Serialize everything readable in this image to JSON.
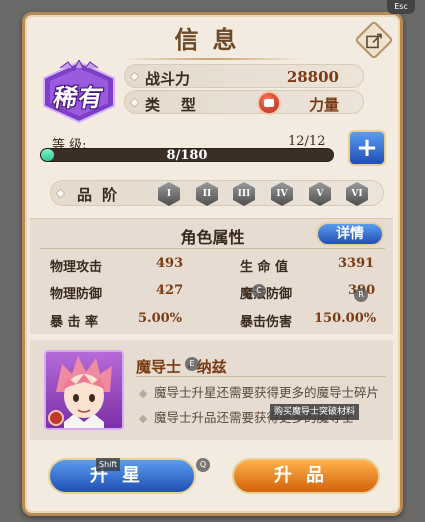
{
  "window": {
    "esc_label": "Esc"
  },
  "header": {
    "title": "信息"
  },
  "rarity": {
    "label": "稀有"
  },
  "stats": {
    "power_label": "战斗力",
    "power_value": "28800",
    "type_label": "类    型",
    "type_value": "力量"
  },
  "level": {
    "label": "等 级:",
    "count": "12/12",
    "xp_text": "8/180",
    "xp_fraction": 0.044
  },
  "grade": {
    "label": "品阶",
    "tiers": [
      "I",
      "II",
      "III",
      "IV",
      "V",
      "VI"
    ]
  },
  "attributes": {
    "title": "角色属性",
    "detail_button": "详情",
    "items": [
      {
        "name": "物理攻击",
        "value": "493"
      },
      {
        "name": "生 命 值",
        "value": "3391"
      },
      {
        "name": "物理防御",
        "value": "427"
      },
      {
        "name": "魔法防御",
        "value": "390"
      },
      {
        "name": "暴 击 率",
        "value": "5.00%"
      },
      {
        "name": "暴击伤害",
        "value": "150.00%"
      }
    ]
  },
  "character": {
    "name": "魔导士 · 纳兹",
    "tips": [
      "魔导士升星还需要获得更多的魔导士碎片",
      "魔导士升品还需要获得更多的魔导士"
    ],
    "tooltip": "购买魔导士突破材料"
  },
  "hints": {
    "e": "E",
    "c": "C",
    "r": "R",
    "q": "Q",
    "shift": "Shift"
  },
  "actions": {
    "star_up": "升星",
    "grade_up": "升品"
  },
  "colors": {
    "panel_bg": "#f3ebdf",
    "border": "#b58a55",
    "blue_button": "#1f4fb3",
    "orange_button": "#d2620c",
    "xp_fill": "#2ec89a"
  }
}
